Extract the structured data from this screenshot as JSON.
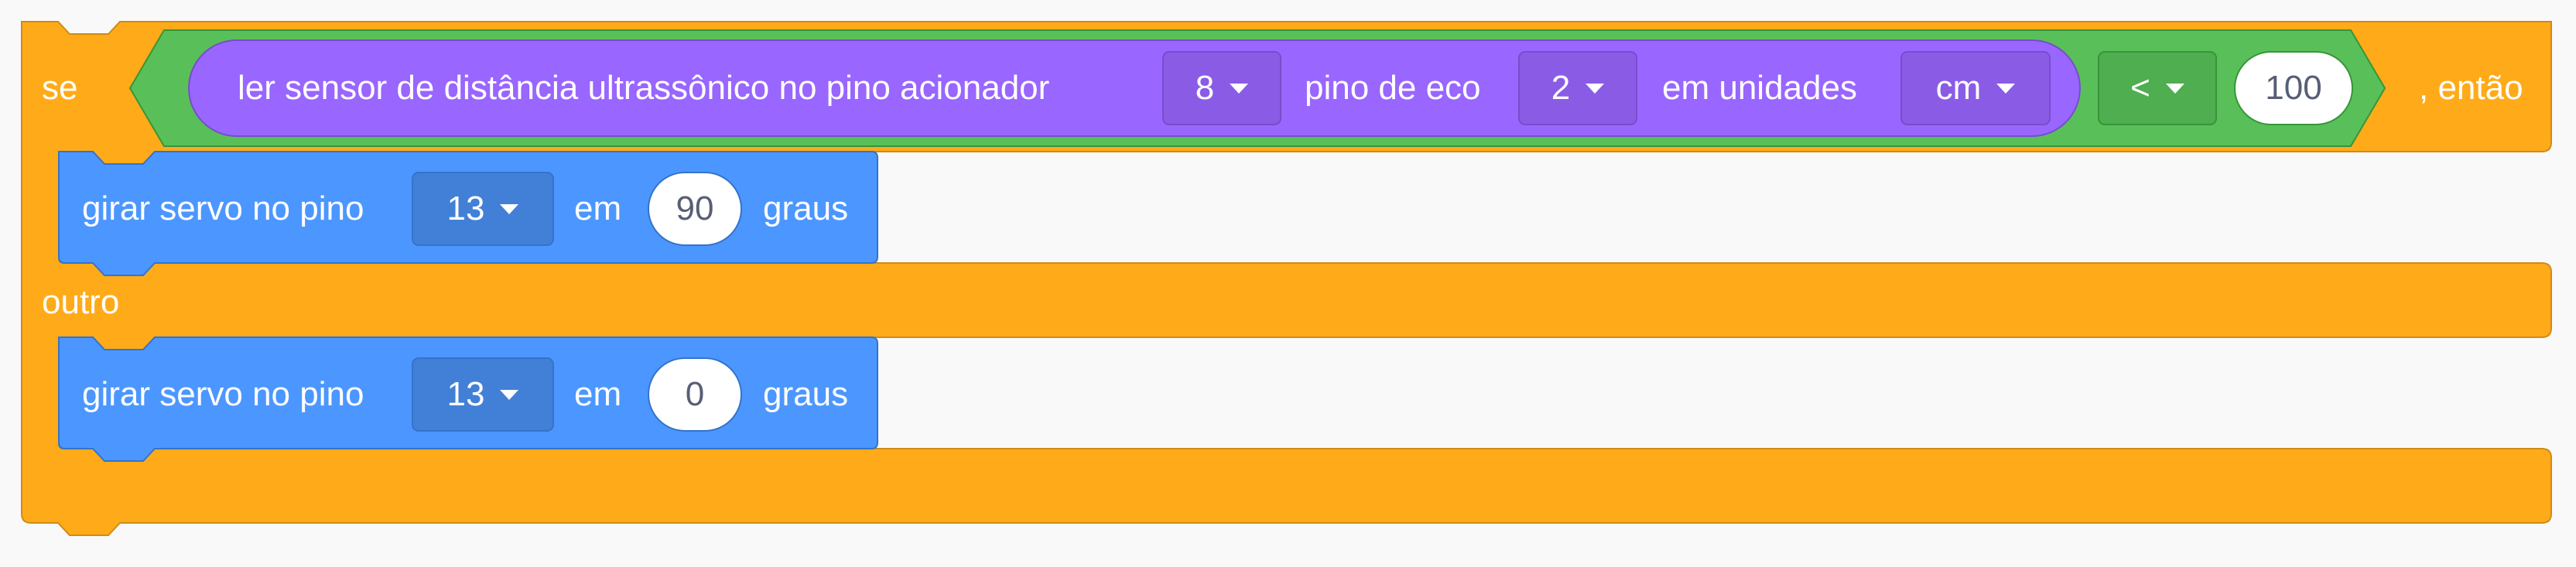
{
  "colors": {
    "control": "#ffab19",
    "control_border": "#cf8b17",
    "operator": "#59c059",
    "operator_border": "#389438",
    "sensor": "#9966ff",
    "sensor_border": "#774dcb",
    "motion": "#4c97ff",
    "motion_border": "#3373cc",
    "field_text": "#575e75",
    "background": "#f9f9f9"
  },
  "if_block": {
    "if_label": "se",
    "then_label": ", então",
    "else_label": "outro"
  },
  "condition": {
    "sensor": {
      "label": "ler sensor de distância ultrassônico no pino acionador",
      "trigger_pin": "8",
      "echo_label": "pino de eco",
      "echo_pin": "2",
      "units_label": "em unidades",
      "units": "cm"
    },
    "operator": "<",
    "value": "100"
  },
  "then_branch": {
    "label": "girar servo no pino",
    "pin": "13",
    "em": "em",
    "angle": "90",
    "unit": "graus"
  },
  "else_branch": {
    "label": "girar servo no pino",
    "pin": "13",
    "em": "em",
    "angle": "0",
    "unit": "graus"
  }
}
